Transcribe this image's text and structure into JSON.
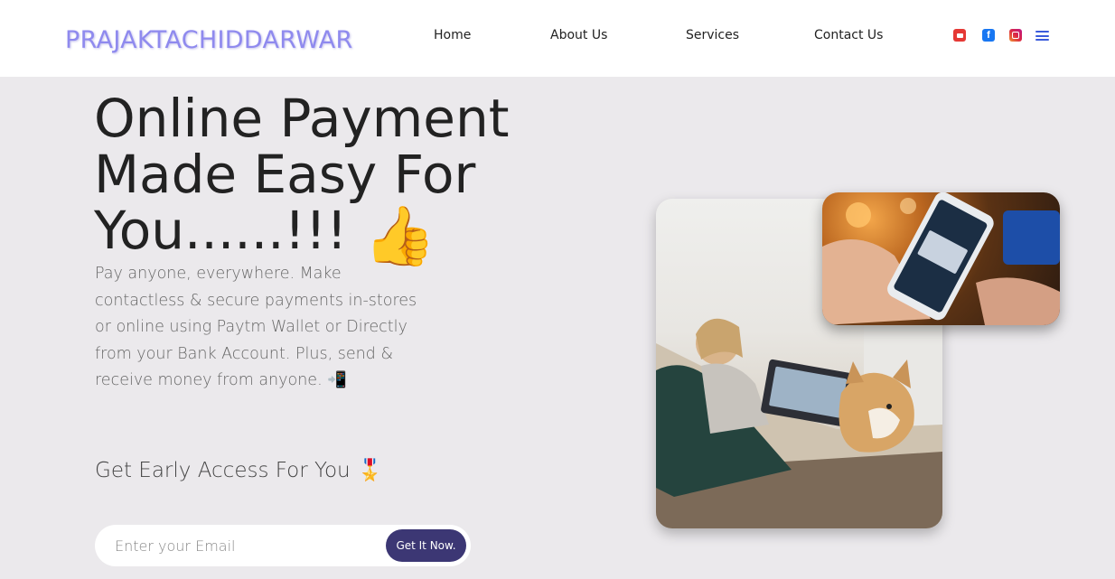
{
  "brand": {
    "logo_text": "PRAJAKTACHIDDARWAR"
  },
  "nav": {
    "items": [
      "Home",
      "About Us",
      "Services",
      "Contact Us"
    ]
  },
  "social": {
    "icons": [
      "youtube-icon",
      "facebook-icon",
      "instagram-icon",
      "menu-icon"
    ],
    "facebook_glyph": "f"
  },
  "hero": {
    "title_line1": "Online Payment",
    "title_line2": "Made Easy For",
    "title_line3": "You......!!!",
    "title_emoji": "👍",
    "description": "Pay anyone, everywhere. Make contactless & secure payments in-stores or online using Paytm Wallet or Directly from your Bank Account. Plus, send & receive money from anyone.",
    "description_emoji": "📲",
    "early_access": "Get Early Access For You",
    "early_access_emoji": "🎖️"
  },
  "form": {
    "email_placeholder": "Enter your Email",
    "cta_label": "Get It Now."
  },
  "colors": {
    "logo": "#8f8aee",
    "cta": "#3c3774",
    "background": "#ebe9ec",
    "navbar": "#ffffff"
  }
}
